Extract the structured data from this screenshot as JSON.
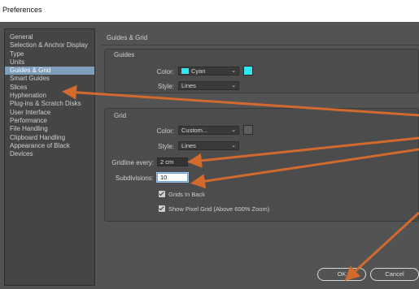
{
  "window": {
    "title": "Preferences"
  },
  "sidebar": {
    "items": [
      {
        "label": "General"
      },
      {
        "label": "Selection & Anchor Display"
      },
      {
        "label": "Type"
      },
      {
        "label": "Units"
      },
      {
        "label": "Guides & Grid",
        "selected": true
      },
      {
        "label": "Smart Guides"
      },
      {
        "label": "Slices"
      },
      {
        "label": "Hyphenation"
      },
      {
        "label": "Plug-ins & Scratch Disks"
      },
      {
        "label": "User Interface"
      },
      {
        "label": "Performance"
      },
      {
        "label": "File Handling"
      },
      {
        "label": "Clipboard Handling"
      },
      {
        "label": "Appearance of Black"
      },
      {
        "label": "Devices"
      }
    ]
  },
  "content": {
    "title": "Guides & Grid",
    "guides": {
      "section_title": "Guides",
      "color_label": "Color:",
      "color_value": "Cyan",
      "style_label": "Style:",
      "style_value": "Lines",
      "swatch_color": "#2ee8f2"
    },
    "grid": {
      "section_title": "Grid",
      "color_label": "Color:",
      "color_value": "Custom...",
      "style_label": "Style:",
      "style_value": "Lines",
      "gridline_label": "Gridline every:",
      "gridline_value": "2 cm",
      "subdivisions_label": "Subdivisions:",
      "subdivisions_value": "10",
      "swatch_color": "#5f5f5f",
      "grids_in_back_label": "Grids In Back",
      "grids_in_back_checked": true,
      "pixel_grid_label": "Show Pixel Grid (Above 600% Zoom)",
      "pixel_grid_checked": true
    }
  },
  "buttons": {
    "ok": "OK",
    "cancel": "Cancel"
  },
  "colors": {
    "dialog_bg": "#535353",
    "annotation_arrow": "#d26a2e",
    "selection": "#7f9fbd"
  }
}
